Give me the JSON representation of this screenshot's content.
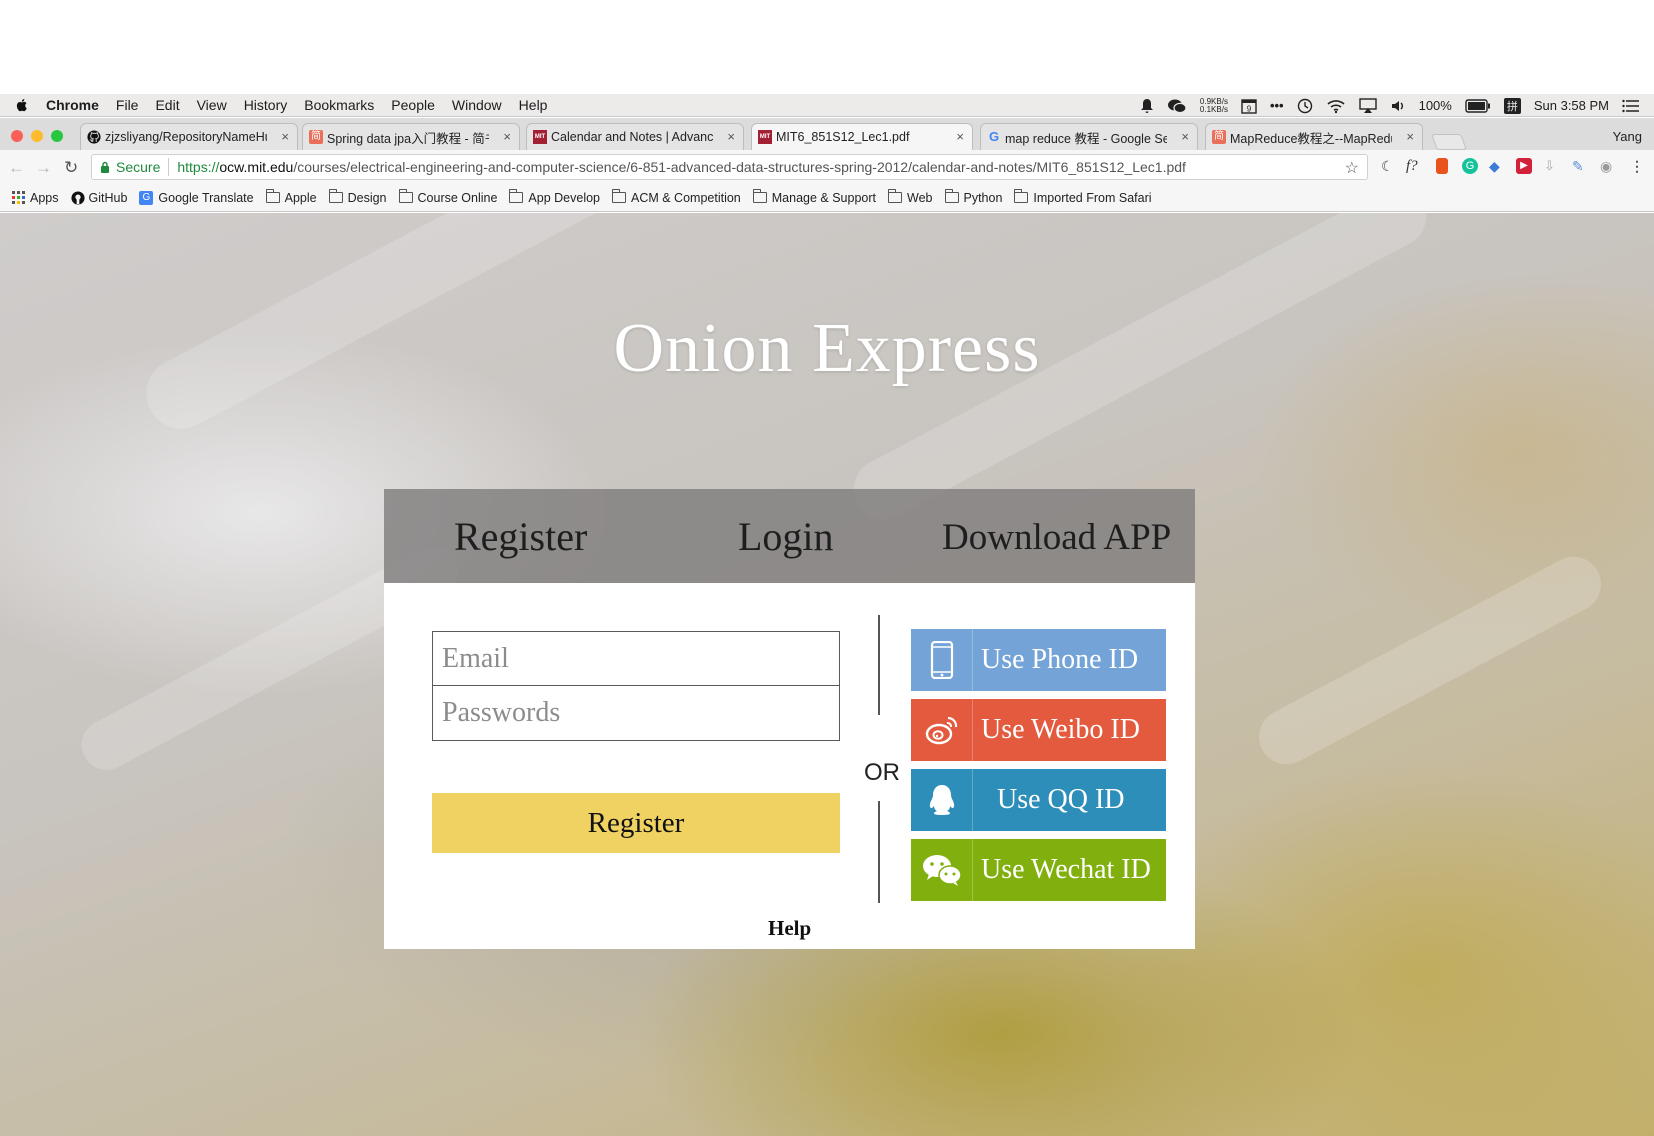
{
  "menubar": {
    "app": "Chrome",
    "items": [
      "File",
      "Edit",
      "View",
      "History",
      "Bookmarks",
      "People",
      "Window",
      "Help"
    ],
    "net_up": "0.9KB/s",
    "net_down": "0.1KB/s",
    "battery": "100%",
    "clock": "Sun 3:58 PM"
  },
  "tabs": [
    {
      "label": "zjzsliyang/RepositoryNameHub",
      "icon": "github-icon"
    },
    {
      "label": "Spring data jpa入门教程 - 简书",
      "icon": "jianshu-icon"
    },
    {
      "label": "Calendar and Notes | Advanced",
      "icon": "mit-icon"
    },
    {
      "label": "MIT6_851S12_Lec1.pdf",
      "icon": "mit-icon"
    },
    {
      "label": "map reduce 教程 - Google Search",
      "icon": "google-icon"
    },
    {
      "label": "MapReduce教程之--MapReduce",
      "icon": "jianshu-icon"
    }
  ],
  "profile_name": "Yang",
  "omnibox": {
    "secure_label": "Secure",
    "scheme": "https://",
    "host": "ocw.mit.edu",
    "path": "/courses/electrical-engineering-and-computer-science/6-851-advanced-data-structures-spring-2012/calendar-and-notes/MIT6_851S12_Lec1.pdf"
  },
  "bookmarks": [
    "Apps",
    "GitHub",
    "Google Translate",
    "Apple",
    "Design",
    "Course Online",
    "App Develop",
    "ACM & Competition",
    "Manage & Support",
    "Web",
    "Python",
    "Imported From Safari"
  ],
  "page": {
    "title": "Onion Express",
    "nav": {
      "register": "Register",
      "login": "Login",
      "download": "Download APP"
    },
    "form": {
      "email_placeholder": "Email",
      "password_placeholder": "Passwords",
      "submit": "Register",
      "help": "Help"
    },
    "or_label": "OR",
    "social": [
      {
        "label": "Use Phone ID",
        "color": "#73a3d7",
        "icon": "phone-icon"
      },
      {
        "label": "Use Weibo ID",
        "color": "#e35a3e",
        "icon": "weibo-icon"
      },
      {
        "label": "Use QQ ID",
        "color": "#2d8fb9",
        "icon": "qq-icon"
      },
      {
        "label": "Use Wechat ID",
        "color": "#80af0e",
        "icon": "wechat-icon"
      }
    ]
  }
}
